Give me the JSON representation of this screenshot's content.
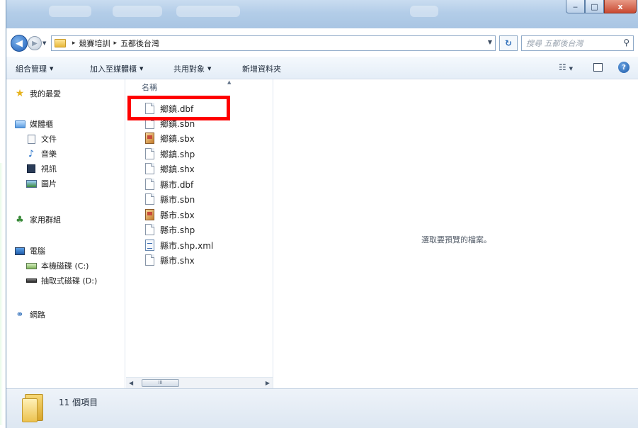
{
  "window": {
    "controls": {
      "minimize": "‒",
      "maximize": "□",
      "close": "x"
    }
  },
  "address_bar": {
    "breadcrumbs": [
      "競賽培訓",
      "五都後台灣"
    ],
    "separator": "▸"
  },
  "search": {
    "placeholder": "搜尋 五都後台灣"
  },
  "toolbar": {
    "organize": "組合管理",
    "add_to_library": "加入至媒體櫃",
    "share_with": "共用對象",
    "new_folder": "新增資料夾",
    "dropdown_arrow": "▼",
    "view_icon": "☷",
    "help": "?"
  },
  "nav_pane": {
    "favorites": "我的最愛",
    "libraries": "媒體櫃",
    "documents": "文件",
    "music": "音樂",
    "videos": "視訊",
    "pictures": "圖片",
    "homegroup": "家用群組",
    "computer": "電腦",
    "local_disk": "本機磁碟 (C:)",
    "removable_disk": "抽取式磁碟 (D:)",
    "network": "網路"
  },
  "file_list": {
    "column_header": "名稱",
    "files": [
      {
        "name": "鄉鎮.dbf",
        "icon": "blank-file-icon"
      },
      {
        "name": "鄉鎮.sbn",
        "icon": "blank-file-icon"
      },
      {
        "name": "鄉鎮.sbx",
        "icon": "sbx-file-icon"
      },
      {
        "name": "鄉鎮.shp",
        "icon": "blank-file-icon"
      },
      {
        "name": "鄉鎮.shx",
        "icon": "blank-file-icon"
      },
      {
        "name": "縣市.dbf",
        "icon": "blank-file-icon"
      },
      {
        "name": "縣市.sbn",
        "icon": "blank-file-icon"
      },
      {
        "name": "縣市.sbx",
        "icon": "sbx-file-icon"
      },
      {
        "name": "縣市.shp",
        "icon": "blank-file-icon"
      },
      {
        "name": "縣市.shp.xml",
        "icon": "xml-file-icon"
      },
      {
        "name": "縣市.shx",
        "icon": "blank-file-icon"
      }
    ],
    "scroll_thumb": "III"
  },
  "preview": {
    "message": "選取要預覽的檔案。"
  },
  "details": {
    "item_count": "11 個項目"
  },
  "colors": {
    "highlight": "#ff0000",
    "titlebar": "#b3cde8",
    "close_button": "#c94a32"
  }
}
